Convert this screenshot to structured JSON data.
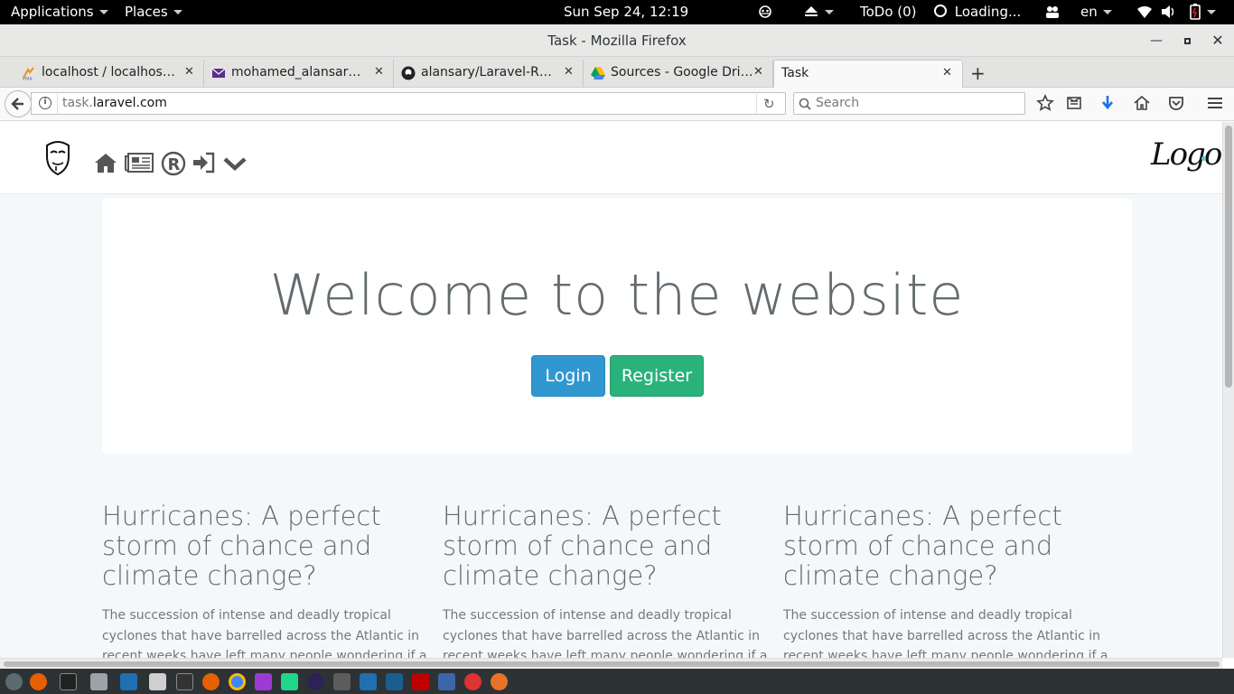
{
  "topbar": {
    "applications": "Applications",
    "places": "Places",
    "datetime": "Sun Sep 24, 12:19",
    "todo": "ToDo (0)",
    "loading": "Loading...",
    "lang": "en"
  },
  "window": {
    "title": "Task - Mozilla Firefox"
  },
  "tabs": [
    {
      "label": "localhost / localhost /...",
      "icon": "phpmyadmin-icon"
    },
    {
      "label": "mohamed_alansary@...",
      "icon": "mail-icon"
    },
    {
      "label": "alansary/Laravel-RES...",
      "icon": "github-icon"
    },
    {
      "label": "Sources - Google Drive",
      "icon": "google-drive-icon"
    },
    {
      "label": "Task",
      "icon": ""
    }
  ],
  "navbar": {
    "url_prefix": "task.",
    "url_domain": "laravel.com",
    "search_placeholder": "Search"
  },
  "site": {
    "logo_text": "Logo",
    "nav_icons": [
      "home-icon",
      "news-icon",
      "register-icon",
      "login-icon",
      "chevron-down-icon"
    ]
  },
  "hero": {
    "title": "Welcome to the website",
    "login_label": "Login",
    "register_label": "Register"
  },
  "articles": [
    {
      "heading": "Hurricanes: A perfect storm of chance and climate change?",
      "body": "The succession of intense and deadly tropical cyclones that have barrelled across the Atlantic in recent weeks have left many people wondering if a threshold of some"
    },
    {
      "heading": "Hurricanes: A perfect storm of chance and climate change?",
      "body": "The succession of intense and deadly tropical cyclones that have barrelled across the Atlantic in recent weeks have left many people wondering if a threshold of some"
    },
    {
      "heading": "Hurricanes: A perfect storm of chance and climate change?",
      "body": "The succession of intense and deadly tropical cyclones that have barrelled across the Atlantic in recent weeks have left many people wondering if a threshold of some"
    }
  ],
  "colors": {
    "login_button": "#3097d1",
    "register_button": "#2ab27b",
    "page_background": "#f5f8fa",
    "heading_text": "#636b6f"
  }
}
